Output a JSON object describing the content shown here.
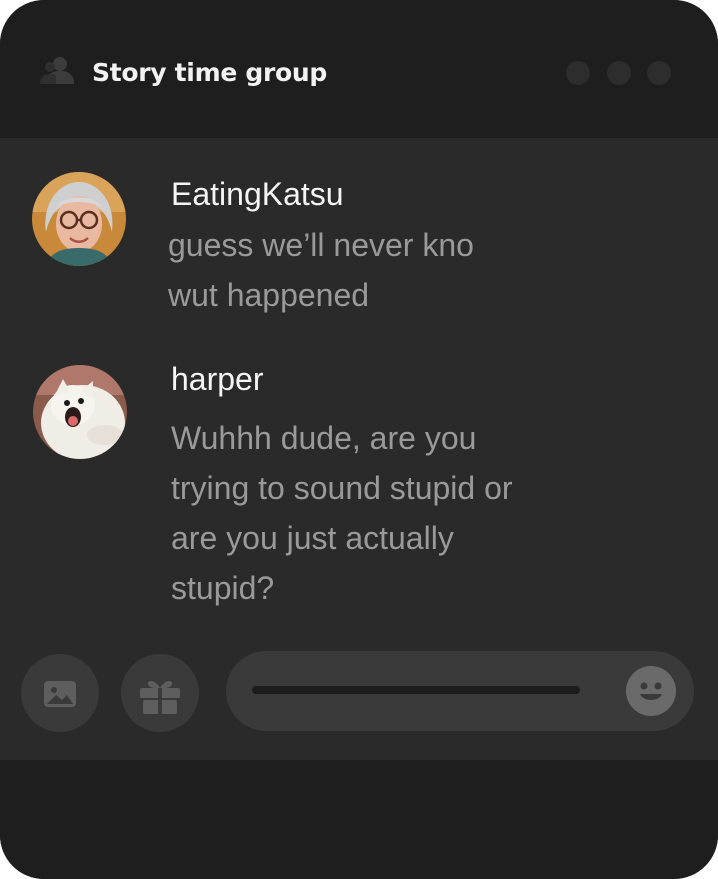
{
  "chat": {
    "title": "Story time group"
  },
  "messages": [
    {
      "username": "EatingKatsu",
      "text": "guess we’ll never kno\nwut happened"
    },
    {
      "username": "harper",
      "text": "Wuhhh dude, are you\ntrying to sound stupid or\nare you just actually\nstupid?"
    }
  ],
  "composer": {
    "image_icon": "image-icon",
    "gift_icon": "gift-icon",
    "emoji_icon": "smiley-icon"
  },
  "colors": {
    "window_bg": "#1e1e1e",
    "content_bg": "#2a2a2a",
    "username": "#f5f5f5",
    "message_text": "#9a9a9a",
    "control_bg": "#3a3a3a"
  }
}
